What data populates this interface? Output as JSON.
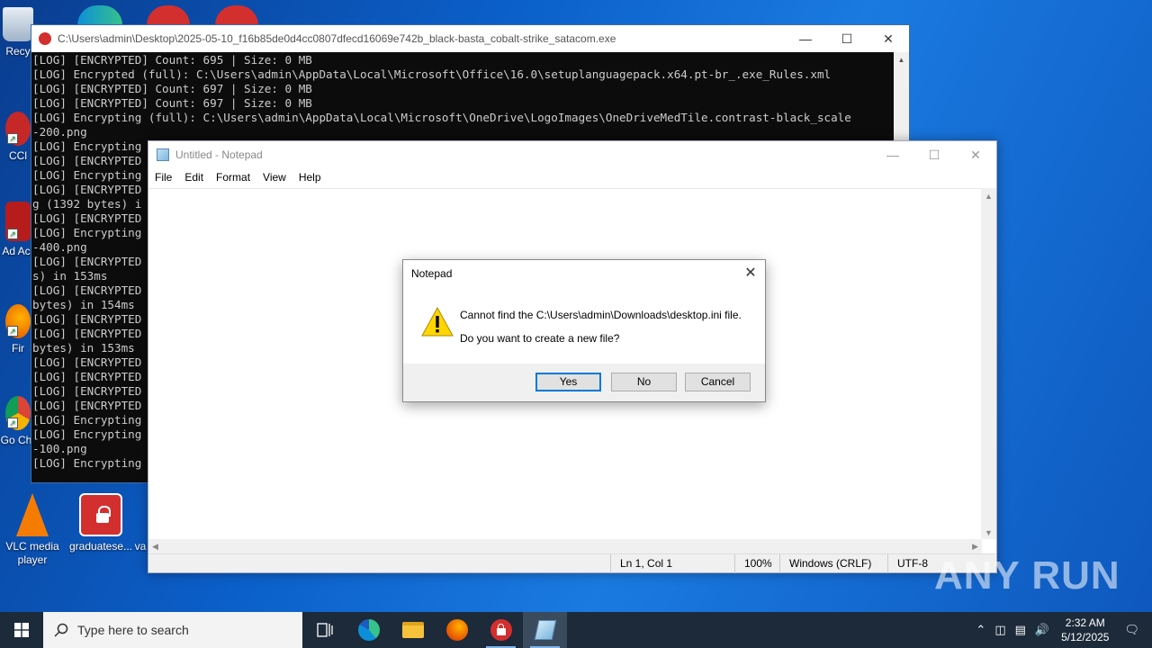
{
  "desktop": {
    "icons": [
      {
        "label": "Recy"
      },
      {
        "label": "CCl"
      },
      {
        "label": "Ad Acr"
      },
      {
        "label": "Fir"
      },
      {
        "label": "Go Chr"
      },
      {
        "label": "VLC media player"
      },
      {
        "label": "graduatese..."
      },
      {
        "label": "va"
      }
    ]
  },
  "console": {
    "title": "C:\\Users\\admin\\Desktop\\2025-05-10_f16b85de0d4cc0807dfecd16069e742b_black-basta_cobalt-strike_satacom.exe",
    "lines": [
      "[LOG] [ENCRYPTED] Count: 695 | Size: 0 MB",
      "[LOG] Encrypted (full): C:\\Users\\admin\\AppData\\Local\\Microsoft\\Office\\16.0\\setuplanguagepack.x64.pt-br_.exe_Rules.xml",
      "[LOG] [ENCRYPTED] Count: 697 | Size: 0 MB",
      "[LOG] [ENCRYPTED] Count: 697 | Size: 0 MB",
      "[LOG] Encrypting (full): C:\\Users\\admin\\AppData\\Local\\Microsoft\\OneDrive\\LogoImages\\OneDriveMedTile.contrast-black_scale",
      "-200.png",
      "[LOG] Encrypting",
      "[LOG] [ENCRYPTED",
      "[LOG] Encrypting",
      "[LOG] [ENCRYPTED",
      "g (1392 bytes) i",
      "[LOG] [ENCRYPTED",
      "[LOG] Encrypting",
      "-400.png",
      "[LOG] [ENCRYPTED",
      "s) in 153ms",
      "[LOG] [ENCRYPTED",
      "bytes) in 154ms",
      "[LOG] [ENCRYPTED",
      "[LOG] [ENCRYPTED",
      "bytes) in 153ms",
      "[LOG] [ENCRYPTED",
      "[LOG] [ENCRYPTED",
      "[LOG] [ENCRYPTED",
      "[LOG] [ENCRYPTED",
      "[LOG] Encrypting",
      "[LOG] Encrypting",
      "-100.png",
      "[LOG] Encrypting"
    ]
  },
  "notepad": {
    "title": "Untitled - Notepad",
    "menu": [
      "File",
      "Edit",
      "Format",
      "View",
      "Help"
    ],
    "status": {
      "position": "Ln 1, Col 1",
      "zoom": "100%",
      "line_ending": "Windows (CRLF)",
      "encoding": "UTF-8"
    }
  },
  "dialog": {
    "title": "Notepad",
    "message_line1": "Cannot find the C:\\Users\\admin\\Downloads\\desktop.ini file.",
    "message_line2": "Do you want to create a new file?",
    "buttons": {
      "yes": "Yes",
      "no": "No",
      "cancel": "Cancel"
    }
  },
  "watermark": {
    "text": "ANY RUN"
  },
  "taskbar": {
    "search_placeholder": "Type here to search",
    "clock_time": "2:32 AM",
    "clock_date": "5/12/2025"
  },
  "colors": {
    "accent": "#0078d7",
    "taskbar": "#1c2a3a",
    "console_bg": "#0c0c0c"
  }
}
